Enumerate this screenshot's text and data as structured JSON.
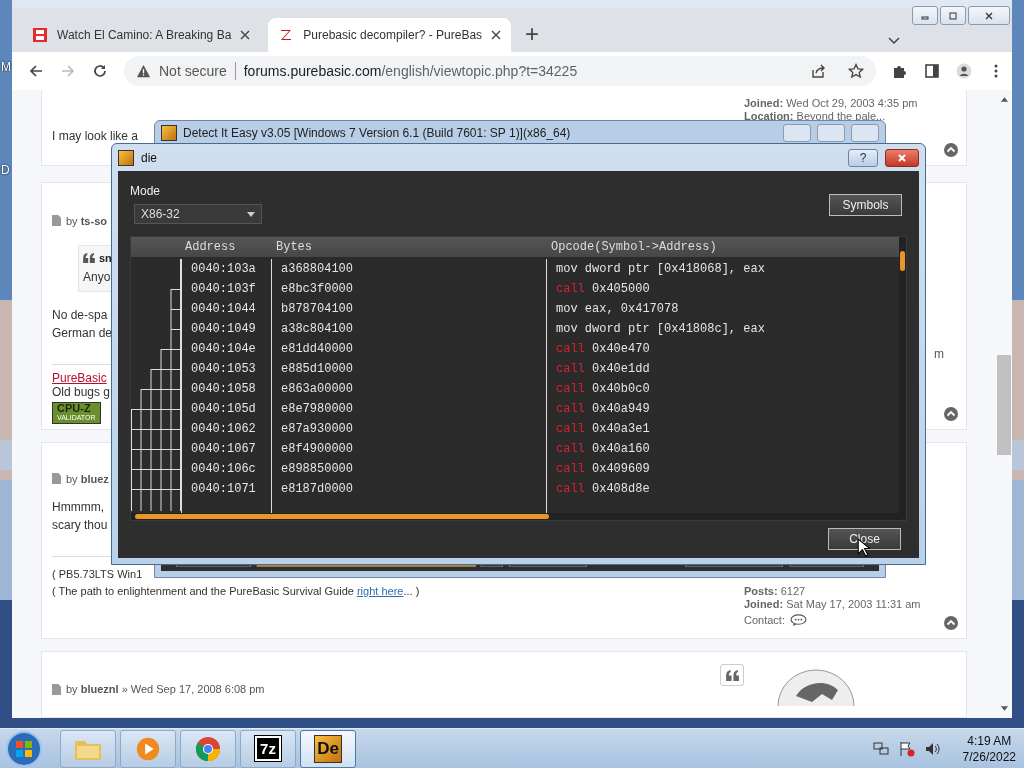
{
  "desktop": {
    "icon_labels": [
      "M",
      "D"
    ]
  },
  "browser": {
    "tabs": [
      {
        "title": "Watch El Camino: A Breaking Ba",
        "kind": "video",
        "selected": false
      },
      {
        "title": "Purebasic decompiler? - PureBas",
        "kind": "forum",
        "selected": true
      }
    ],
    "new_tab": "+",
    "nav": {
      "back_disabled": false,
      "forward_disabled": true
    },
    "address": {
      "security": "Not secure",
      "domain": "forums.purebasic.com",
      "path": "/english/viewtopic.php?t=34225"
    }
  },
  "forum": {
    "posts": [
      {
        "author_info": [
          "**Joined:** Wed Oct 29, 2003 4:35 pm",
          "**Location:** Beyond the pale..."
        ],
        "body": [
          "I may look like a"
        ]
      },
      {
        "byline": "by **ts-so**",
        "quote": {
          "author": "sn",
          "text": "Anyo"
        },
        "body": [
          "No de-spa",
          "German de"
        ],
        "signature": {
          "link": "PureBasic",
          "lines": [
            "Old bugs g"
          ]
        },
        "badge": {
          "line1": "CPU-Z",
          "line2": "VALIDATOR"
        },
        "side_text": "m"
      },
      {
        "byline": "by **bluez**",
        "body": [
          "Hmmmm,",
          "scary thou"
        ],
        "signature": {
          "lines": [
            "( PB5.73LTS Win1"
          ],
          "link_line": {
            "before": "( The path to enlightenment and the PureBasic Survival Guide ",
            "link": "right here",
            "after": "... )"
          }
        },
        "author_info": [
          "**Posts:** 6127",
          "**Joined:** Sat May 17, 2003 11:31 am"
        ],
        "contact_label": "Contact:"
      },
      {
        "byline": "by **blueznl** » Wed Sep 17, 2008 6:08 pm"
      }
    ]
  },
  "background_window": {
    "title": "Detect It Easy v3.05 [Windows 7 Version 6.1 (Build 7601: SP 1)](x86_64)"
  },
  "dialog": {
    "title": "die",
    "help_button": "?",
    "mode_label": "Mode",
    "mode": "X86-32",
    "symbols_button": "Symbols",
    "columns": [
      "Address",
      "Bytes",
      "Opcode(Symbol->Address)"
    ],
    "rows": [
      {
        "address": "0040:103a",
        "bytes": "a368804100",
        "kind": "move",
        "mnemonic": "mov",
        "operand": "dword ptr [0x418068], eax"
      },
      {
        "address": "0040:103f",
        "bytes": "e8bc3f0000",
        "kind": "call",
        "mnemonic": "call",
        "operand": "0x405000"
      },
      {
        "address": "0040:1044",
        "bytes": "b878704100",
        "kind": "move",
        "mnemonic": "mov",
        "operand": "eax, 0x417078"
      },
      {
        "address": "0040:1049",
        "bytes": "a38c804100",
        "kind": "move",
        "mnemonic": "mov",
        "operand": "dword ptr [0x41808c], eax"
      },
      {
        "address": "0040:104e",
        "bytes": "e81dd40000",
        "kind": "call",
        "mnemonic": "call",
        "operand": "0x40e470"
      },
      {
        "address": "0040:1053",
        "bytes": "e885d10000",
        "kind": "call",
        "mnemonic": "call",
        "operand": "0x40e1dd"
      },
      {
        "address": "0040:1058",
        "bytes": "e863a00000",
        "kind": "call",
        "mnemonic": "call",
        "operand": "0x40b0c0"
      },
      {
        "address": "0040:105d",
        "bytes": "e8e7980000",
        "kind": "call",
        "mnemonic": "call",
        "operand": "0x40a949"
      },
      {
        "address": "0040:1062",
        "bytes": "e87a930000",
        "kind": "call",
        "mnemonic": "call",
        "operand": "0x40a3e1"
      },
      {
        "address": "0040:1067",
        "bytes": "e8f4900000",
        "kind": "call",
        "mnemonic": "call",
        "operand": "0x40a160"
      },
      {
        "address": "0040:106c",
        "bytes": "e898850000",
        "kind": "call",
        "mnemonic": "call",
        "operand": "0x409609"
      },
      {
        "address": "0040:1071",
        "bytes": "e8187d0000",
        "kind": "call",
        "mnemonic": "call",
        "operand": "0x408d8e"
      }
    ],
    "close_button": "Close"
  },
  "taskbar": {
    "apps": [
      {
        "kind": "folder",
        "selected": false
      },
      {
        "kind": "media",
        "selected": false
      },
      {
        "kind": "chrome",
        "selected": false
      },
      {
        "kind": "archiver",
        "label": "7z",
        "selected": false
      },
      {
        "kind": "die",
        "label": "De",
        "selected": true
      }
    ],
    "time": "4:19 AM",
    "date": "7/26/2022"
  }
}
